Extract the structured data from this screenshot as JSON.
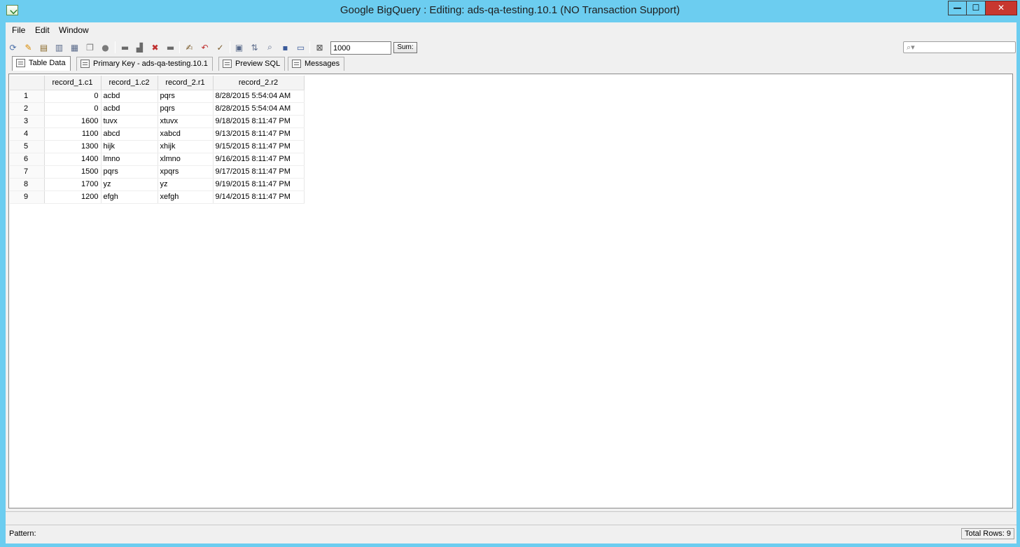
{
  "window": {
    "title": "Google BigQuery : Editing: ads-qa-testing.10.1 (NO Transaction Support)",
    "controls": {
      "minimize": "—",
      "maximize": "☐",
      "close": "✕"
    }
  },
  "menu": [
    "File",
    "Edit",
    "Window"
  ],
  "toolbar": {
    "icons": [
      "refresh-icon",
      "edit-icon",
      "copy-table-icon",
      "paste-table-icon",
      "print-icon",
      "copy-icon",
      "stop-icon",
      "insert-row-icon",
      "add-row-icon",
      "delete-row-icon",
      "remove-row-icon",
      "sql-editor-icon",
      "rollback-icon",
      "commit-icon",
      "filter-icon",
      "sort-icon",
      "find-icon",
      "columns-icon",
      "form-view-icon",
      "clear-filter-icon"
    ],
    "limit_value": "1000",
    "sum_label": "Sum:",
    "search_placeholder": ""
  },
  "tabs": [
    "Table Data",
    "Primary Key - ads-qa-testing.10.1",
    "Preview SQL",
    "Messages"
  ],
  "table": {
    "columns": [
      "record_1.c1",
      "record_1.c2",
      "record_2.r1",
      "record_2.r2"
    ],
    "rows": [
      [
        "1",
        "0",
        "acbd",
        "pqrs",
        "8/28/2015 5:54:04 AM"
      ],
      [
        "2",
        "0",
        "acbd",
        "pqrs",
        "8/28/2015 5:54:04 AM"
      ],
      [
        "3",
        "1600",
        "tuvx",
        "xtuvx",
        "9/18/2015 8:11:47 PM"
      ],
      [
        "4",
        "1100",
        "abcd",
        "xabcd",
        "9/13/2015 8:11:47 PM"
      ],
      [
        "5",
        "1300",
        "hijk",
        "xhijk",
        "9/15/2015 8:11:47 PM"
      ],
      [
        "6",
        "1400",
        "lmno",
        "xlmno",
        "9/16/2015 8:11:47 PM"
      ],
      [
        "7",
        "1500",
        "pqrs",
        "xpqrs",
        "9/17/2015 8:11:47 PM"
      ],
      [
        "8",
        "1700",
        "yz",
        "yz",
        "9/19/2015 8:11:47 PM"
      ],
      [
        "9",
        "1200",
        "efgh",
        "xefgh",
        "9/14/2015 8:11:47 PM"
      ]
    ]
  },
  "status": {
    "pattern_label": "Pattern:",
    "total_rows": "Total Rows: 9"
  }
}
